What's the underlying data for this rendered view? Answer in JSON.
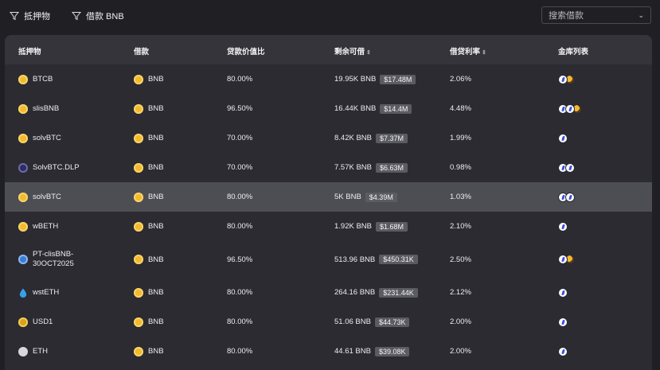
{
  "filters": {
    "collateral": "抵押物",
    "borrow": "借款 BNB"
  },
  "search": {
    "placeholder": "搜索借款"
  },
  "table": {
    "headers": {
      "collateral": "抵押物",
      "borrow": "借款",
      "ltv": "贷款价值比",
      "remaining": "剩余可借",
      "rate": "借贷利率",
      "vaults": "金库列表"
    },
    "rows": [
      {
        "collateral": "BTCB",
        "collateral_icon": "btcb-coin-icon",
        "borrow": "BNB",
        "ltv": "80.00%",
        "remaining": "19.95K BNB",
        "usd": "$17.48M",
        "rate": "2.06%",
        "vaults": [
          "white",
          "multi"
        ]
      },
      {
        "collateral": "slisBNB",
        "collateral_icon": "slisbnb-coin-icon",
        "borrow": "BNB",
        "ltv": "96.50%",
        "remaining": "16.44K BNB",
        "usd": "$14.4M",
        "rate": "4.48%",
        "vaults": [
          "white",
          "white",
          "multi"
        ]
      },
      {
        "collateral": "solvBTC",
        "collateral_icon": "solvbtc-coin-icon",
        "borrow": "BNB",
        "ltv": "70.00%",
        "remaining": "8.42K BNB",
        "usd": "$7.37M",
        "rate": "1.99%",
        "vaults": [
          "white"
        ]
      },
      {
        "collateral": "SolvBTC.DLP",
        "collateral_icon": "solvbtc-dlp-coin-icon",
        "borrow": "BNB",
        "ltv": "70.00%",
        "remaining": "7.57K BNB",
        "usd": "$6.63M",
        "rate": "0.98%",
        "vaults": [
          "white",
          "white"
        ]
      },
      {
        "collateral": "solvBTC",
        "collateral_icon": "solvbtc-coin-icon",
        "borrow": "BNB",
        "ltv": "80.00%",
        "remaining": "5K BNB",
        "usd": "$4.39M",
        "rate": "1.03%",
        "vaults": [
          "white",
          "white"
        ],
        "highlight": true
      },
      {
        "collateral": "wBETH",
        "collateral_icon": "wbeth-coin-icon",
        "borrow": "BNB",
        "ltv": "80.00%",
        "remaining": "1.92K BNB",
        "usd": "$1.68M",
        "rate": "2.10%",
        "vaults": [
          "white"
        ]
      },
      {
        "collateral": "PT-clisBNB-",
        "collateral2": "30OCT2025",
        "collateral_icon": "pt-clisbnb-coin-icon",
        "borrow": "BNB",
        "ltv": "96.50%",
        "remaining": "513.96 BNB",
        "usd": "$450.31K",
        "rate": "2.50%",
        "vaults": [
          "white",
          "multi"
        ]
      },
      {
        "collateral": "wstETH",
        "collateral_icon": "wsteth-coin-icon",
        "borrow": "BNB",
        "ltv": "80.00%",
        "remaining": "264.16 BNB",
        "usd": "$231.44K",
        "rate": "2.12%",
        "vaults": [
          "white"
        ]
      },
      {
        "collateral": "USD1",
        "collateral_icon": "usd1-coin-icon",
        "borrow": "BNB",
        "ltv": "80.00%",
        "remaining": "51.06 BNB",
        "usd": "$44.73K",
        "rate": "2.00%",
        "vaults": [
          "white"
        ]
      },
      {
        "collateral": "ETH",
        "collateral_icon": "eth-coin-icon",
        "borrow": "BNB",
        "ltv": "80.00%",
        "remaining": "44.61 BNB",
        "usd": "$39.08K",
        "rate": "2.00%",
        "vaults": [
          "white"
        ]
      }
    ]
  },
  "colors": {
    "background": "#1f1f24",
    "panel": "#2b2b31",
    "header": "#34343a",
    "highlight_row": "#4d4d54",
    "bnb_yellow": "#f3ba2f"
  }
}
